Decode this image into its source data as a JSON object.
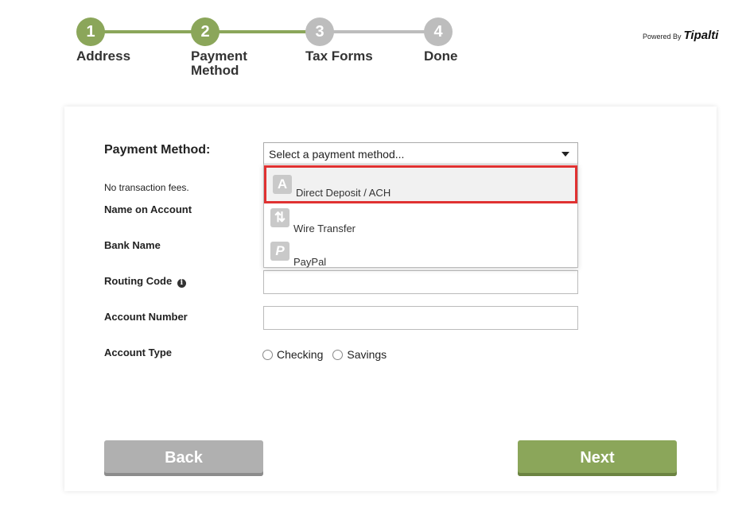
{
  "stepper": {
    "steps": [
      {
        "number": "1",
        "label": "Address",
        "status": "done"
      },
      {
        "number": "2",
        "label": "Payment Method",
        "status": "current"
      },
      {
        "number": "3",
        "label": "Tax Forms",
        "status": "todo"
      },
      {
        "number": "4",
        "label": "Done",
        "status": "todo"
      }
    ]
  },
  "branding": {
    "powered_by": "Powered By",
    "brand": "Tipalti"
  },
  "form": {
    "payment_method_label": "Payment Method:",
    "select_value": "Select a payment method...",
    "fee_note": "No transaction fees.",
    "name_on_account_label": "Name on Account",
    "bank_name_label": "Bank Name",
    "routing_code_label": "Routing Code",
    "account_number_label": "Account Number",
    "account_type_label": "Account Type",
    "account_types": [
      "Checking",
      "Savings"
    ]
  },
  "dropdown": {
    "options": [
      {
        "label": "Direct Deposit / ACH",
        "icon": "A",
        "icon_name": "ach-icon",
        "highlighted": true
      },
      {
        "label": "Wire Transfer",
        "icon": "⇅",
        "icon_name": "wire-transfer-icon",
        "highlighted": false
      },
      {
        "label": "PayPal",
        "icon": "P",
        "icon_name": "paypal-icon",
        "highlighted": false
      }
    ]
  },
  "buttons": {
    "back": "Back",
    "next": "Next"
  },
  "colors": {
    "accent": "#8ba65a",
    "inactive": "#bdbdbd",
    "highlight_border": "#e03131"
  }
}
